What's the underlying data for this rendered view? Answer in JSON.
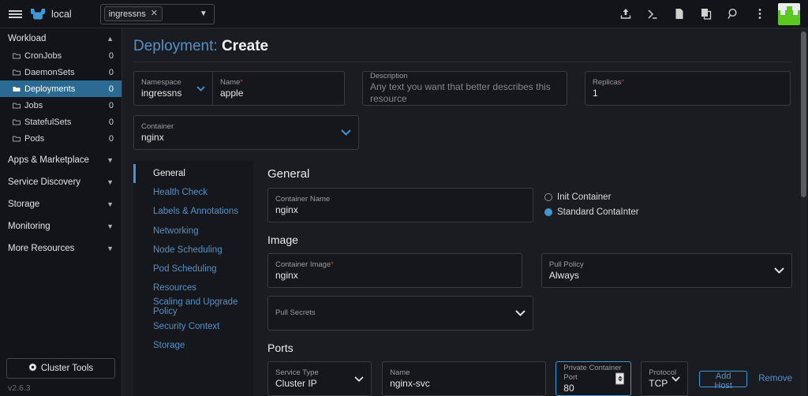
{
  "topbar": {
    "menu_icon": "hamburger-icon",
    "logo_icon": "rancher-cow-logo",
    "cluster_name": "local",
    "namespace_picker": {
      "chip_label": "ingressns",
      "remove_icon": "close-icon",
      "caret_icon": "chevron-down-icon"
    },
    "actions": [
      {
        "name": "import-yaml-icon",
        "glyph": "import"
      },
      {
        "name": "kubectl-shell-icon",
        "glyph": "shell"
      },
      {
        "name": "docs-icon",
        "glyph": "file"
      },
      {
        "name": "copy-kubeconfig-icon",
        "glyph": "copy"
      },
      {
        "name": "search-icon",
        "glyph": "search"
      },
      {
        "name": "more-options-icon",
        "glyph": "kebab"
      }
    ],
    "app_logo": "green-block-logo"
  },
  "sidebar": {
    "groups": [
      {
        "label": "Workload",
        "expanded": true,
        "chevron": "chevron-up-icon",
        "items": [
          {
            "label": "CronJobs",
            "count": "0",
            "active": false
          },
          {
            "label": "DaemonSets",
            "count": "0",
            "active": false
          },
          {
            "label": "Deployments",
            "count": "0",
            "active": true
          },
          {
            "label": "Jobs",
            "count": "0",
            "active": false
          },
          {
            "label": "StatefulSets",
            "count": "0",
            "active": false
          },
          {
            "label": "Pods",
            "count": "0",
            "active": false
          }
        ]
      },
      {
        "label": "Apps & Marketplace",
        "expanded": false,
        "chevron": "chevron-down-icon",
        "items": []
      },
      {
        "label": "Service Discovery",
        "expanded": false,
        "chevron": "chevron-down-icon",
        "items": []
      },
      {
        "label": "Storage",
        "expanded": false,
        "chevron": "chevron-down-icon",
        "items": []
      },
      {
        "label": "Monitoring",
        "expanded": false,
        "chevron": "chevron-down-icon",
        "items": []
      },
      {
        "label": "More Resources",
        "expanded": false,
        "chevron": "chevron-down-icon",
        "items": []
      }
    ],
    "cluster_tools_label": "Cluster Tools",
    "cluster_tools_icon": "gear-icon",
    "version": "v2.6.3"
  },
  "page": {
    "title_resource": "Deployment:",
    "title_action": "Create"
  },
  "meta_fields": {
    "namespace": {
      "label": "Namespace",
      "value": "ingressns",
      "caret": "chevron-down-icon"
    },
    "name": {
      "label": "Name",
      "required": "*",
      "value": "apple"
    },
    "description": {
      "label": "Description",
      "placeholder": "Any text you want that better describes this resource",
      "value": ""
    },
    "replicas": {
      "label": "Replicas",
      "required": "*",
      "value": "1"
    }
  },
  "container_select": {
    "label": "Container",
    "value": "nginx",
    "caret": "chevron-down-icon"
  },
  "tabs": [
    {
      "label": "General",
      "active": true
    },
    {
      "label": "Health Check",
      "active": false
    },
    {
      "label": "Labels & Annotations",
      "active": false
    },
    {
      "label": "Networking",
      "active": false
    },
    {
      "label": "Node Scheduling",
      "active": false
    },
    {
      "label": "Pod Scheduling",
      "active": false
    },
    {
      "label": "Resources",
      "active": false
    },
    {
      "label": "Scaling and Upgrade Policy",
      "active": false
    },
    {
      "label": "Security Context",
      "active": false
    },
    {
      "label": "Storage",
      "active": false
    }
  ],
  "general": {
    "heading": "General",
    "container_name": {
      "label": "Container Name",
      "value": "nginx"
    },
    "container_type": {
      "options": [
        {
          "label": "Init Container",
          "selected": false
        },
        {
          "label": "Standard ContaInter",
          "selected": true
        }
      ]
    }
  },
  "image": {
    "heading": "Image",
    "container_image": {
      "label": "Container Image",
      "required": "*",
      "value": "nginx"
    },
    "pull_policy": {
      "label": "Pull Policy",
      "value": "Always",
      "caret": "chevron-down-icon"
    },
    "pull_secrets": {
      "label": "Pull Secrets",
      "value": "",
      "caret": "chevron-down-icon"
    }
  },
  "ports": {
    "heading": "Ports",
    "service_type": {
      "label": "Service Type",
      "value": "Cluster IP",
      "caret": "chevron-down-icon"
    },
    "name": {
      "label": "Name",
      "value": "nginx-svc"
    },
    "private_container_port": {
      "label": "Private Container Port",
      "value": "80",
      "focused": true,
      "spinner": "number-spinner"
    },
    "protocol": {
      "label": "Protocol",
      "value": "TCP",
      "caret": "chevron-down-icon"
    },
    "add_host_label": "Add Host",
    "remove_label": "Remove"
  },
  "colors": {
    "accent_blue": "#3d98d3",
    "link_blue": "#5691c4",
    "active_nav": "#2b6a92",
    "required_red": "#d4352c",
    "logo_green": "#5bc721",
    "bg": "#1b1c21",
    "panel_bg": "#16171c"
  }
}
